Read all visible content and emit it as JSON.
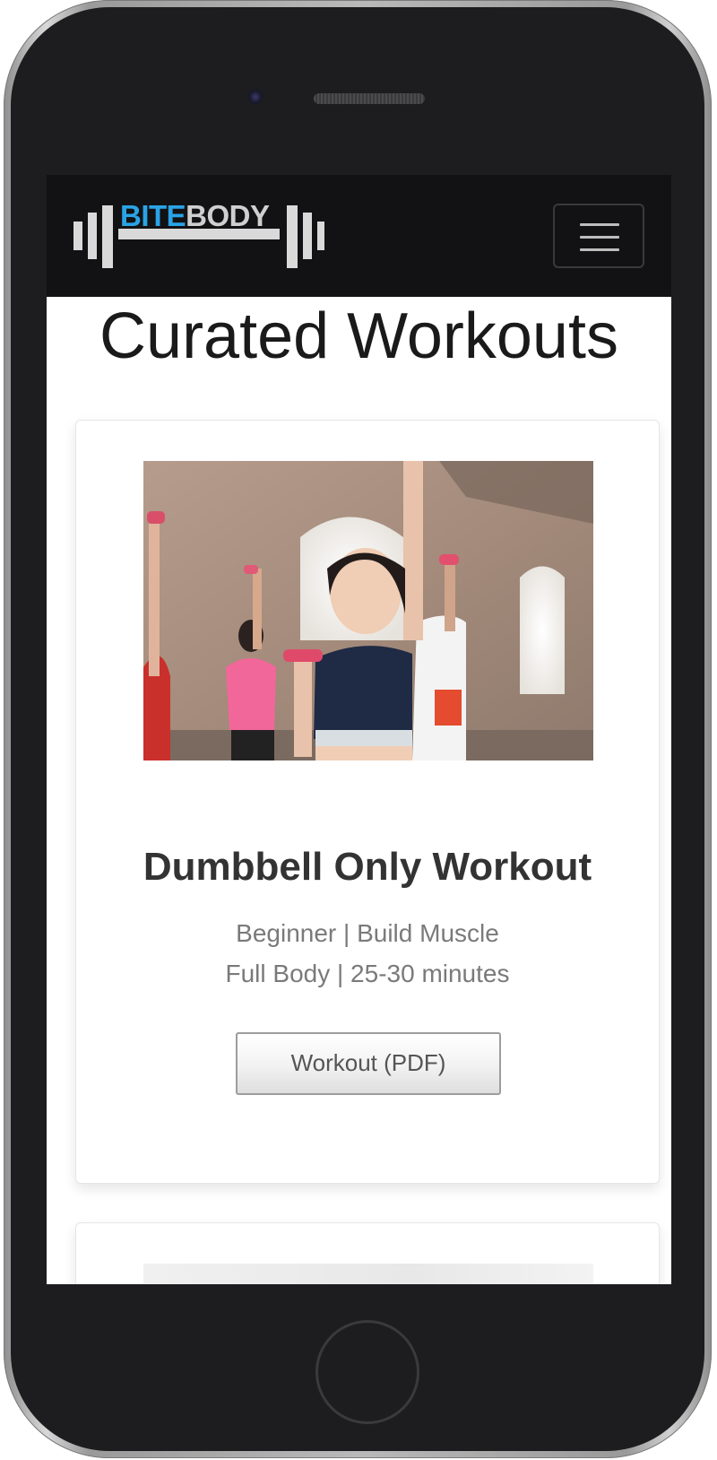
{
  "brand": {
    "logo_part_1": "BITE",
    "logo_part_2": "BODY",
    "logo_accent_color": "#2aa3e6",
    "logo_secondary_color": "#cfcfcf",
    "navbar_color": "#121214"
  },
  "nav": {
    "menu_icon": "hamburger-menu-icon"
  },
  "page": {
    "title": "Curated Workouts"
  },
  "workouts": [
    {
      "image": "women-exercising-with-pink-dumbbells-photo",
      "title": "Dumbbell Only Workout",
      "meta_line_1": "Beginner | Build Muscle",
      "meta_line_2": "Full Body | 25-30 minutes",
      "button_label": "Workout (PDF)"
    }
  ]
}
